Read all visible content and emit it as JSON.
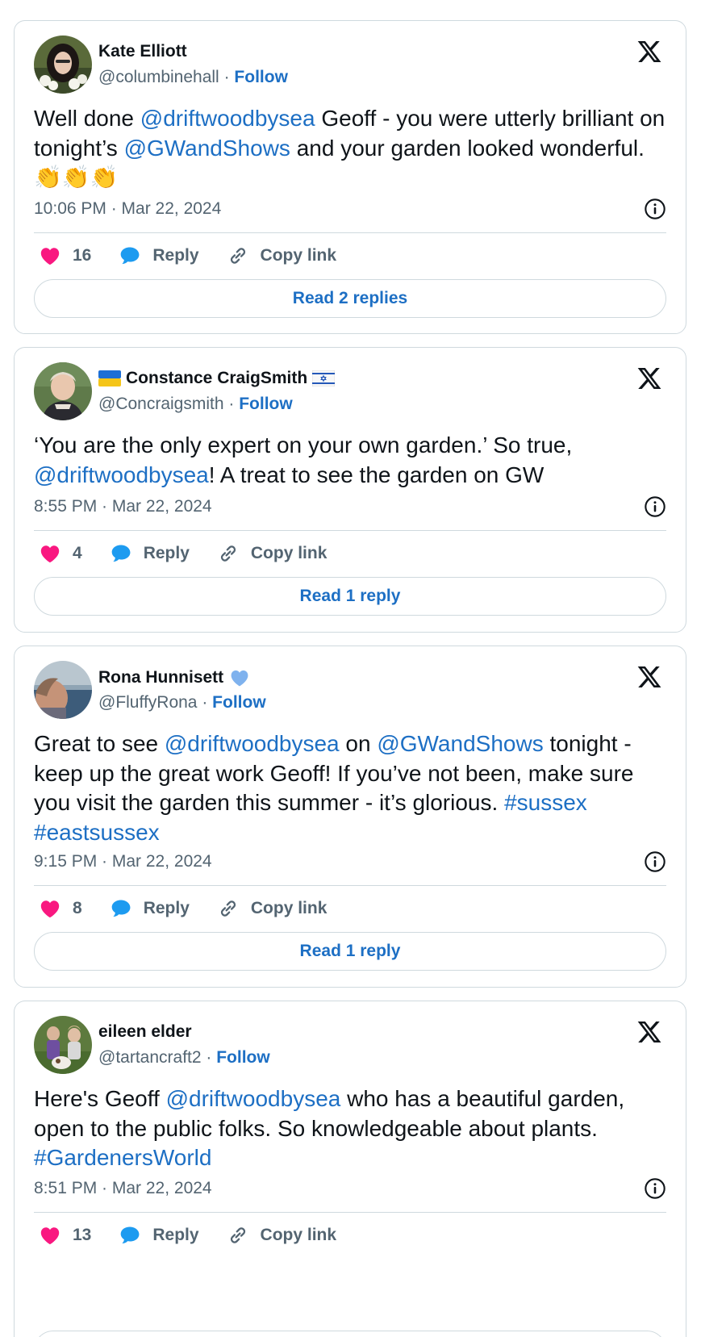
{
  "tweets": [
    {
      "name": "Kate Elliott",
      "handle": "@columbinehall",
      "sep": "·",
      "follow": "Follow",
      "text": [
        {
          "t": "Well done "
        },
        {
          "t": "@driftwoodbysea",
          "link": true
        },
        {
          "t": " Geoff - you were utterly brilliant on tonight’s "
        },
        {
          "t": "@GWandShows",
          "link": true
        },
        {
          "t": " and your garden looked wonderful. 👏👏👏"
        }
      ],
      "timestamp": "10:06 PM · Mar 22, 2024",
      "likes": "16",
      "reply_label": "Reply",
      "copy_label": "Copy link",
      "read_label": "Read 2 replies"
    },
    {
      "name": "Constance CraigSmith",
      "handle": "@Concraigsmith",
      "sep": "·",
      "follow": "Follow",
      "text": [
        {
          "t": "‘You are the only expert on your own garden.’ So true, "
        },
        {
          "t": "@driftwoodbysea",
          "link": true
        },
        {
          "t": "! A treat to see the garden on GW"
        }
      ],
      "timestamp": "8:55 PM · Mar 22, 2024",
      "likes": "4",
      "reply_label": "Reply",
      "copy_label": "Copy link",
      "read_label": "Read 1 reply"
    },
    {
      "name": "Rona Hunnisett",
      "handle": "@FluffyRona",
      "sep": "·",
      "follow": "Follow",
      "text": [
        {
          "t": "Great to see "
        },
        {
          "t": "@driftwoodbysea",
          "link": true
        },
        {
          "t": " on "
        },
        {
          "t": "@GWandShows",
          "link": true
        },
        {
          "t": " tonight - keep up the great work Geoff! If you’ve not been, make sure you visit the garden this summer - it’s glorious. "
        },
        {
          "t": "#sussex",
          "link": true
        },
        {
          "t": " "
        },
        {
          "t": "#eastsussex",
          "link": true
        }
      ],
      "timestamp": "9:15 PM · Mar 22, 2024",
      "likes": "8",
      "reply_label": "Reply",
      "copy_label": "Copy link",
      "read_label": "Read 1 reply"
    },
    {
      "name": "eileen elder",
      "handle": "@tartancraft2",
      "sep": "·",
      "follow": "Follow",
      "text": [
        {
          "t": "Here's Geoff "
        },
        {
          "t": "@driftwoodbysea",
          "link": true
        },
        {
          "t": "  who has a beautiful garden, open to the public folks. So knowledgeable about plants. "
        },
        {
          "t": "#GardenersWorld",
          "link": true
        }
      ],
      "timestamp": "8:51 PM · Mar 22, 2024",
      "likes": "13",
      "reply_label": "Reply",
      "copy_label": "Copy link"
    }
  ],
  "colors": {
    "link": "#1d6fc4",
    "heart": "#f91880",
    "reply_bubble": "#1d9bf0",
    "border": "#cfd9de"
  }
}
